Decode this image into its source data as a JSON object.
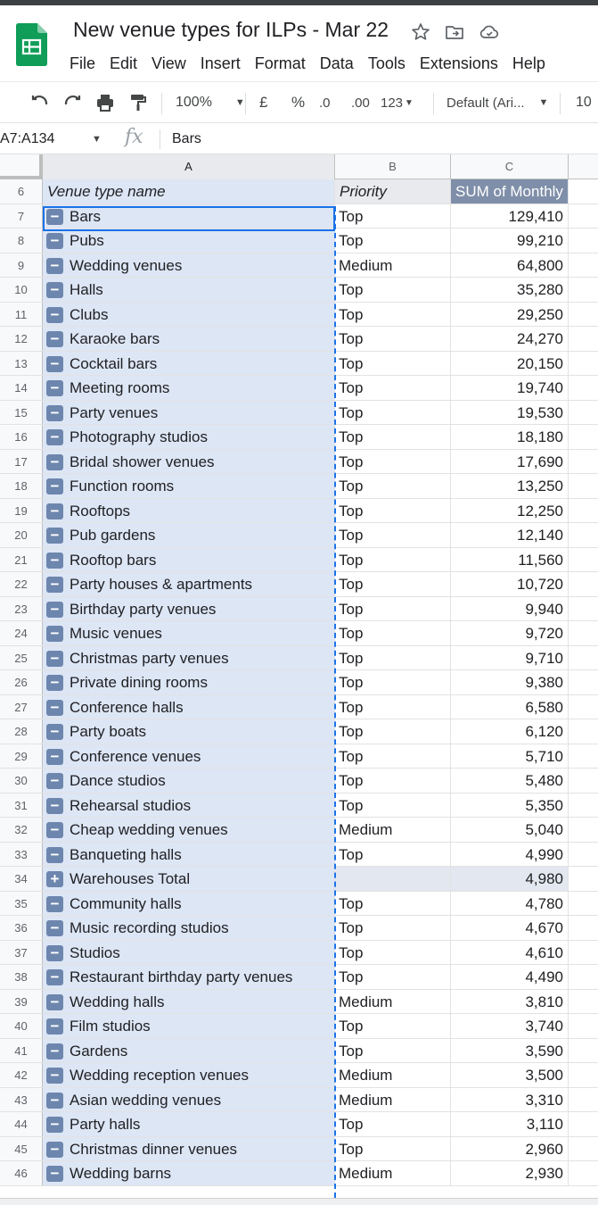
{
  "document": {
    "title": "New venue types for ILPs - Mar 22"
  },
  "menu": [
    "File",
    "Edit",
    "View",
    "Insert",
    "Format",
    "Data",
    "Tools",
    "Extensions",
    "Help"
  ],
  "toolbar": {
    "zoom": "100%",
    "currency": "£",
    "percent": "%",
    "decrease_decimals": ".0",
    "increase_decimals": ".00",
    "more_formats": "123",
    "font": "Default (Ari...",
    "font_size": "10"
  },
  "formula_bar": {
    "name_box": "A7:A134",
    "fx": "fx",
    "value": "Bars"
  },
  "columns": [
    "A",
    "B",
    "C"
  ],
  "header_row": {
    "row_number": "6",
    "col_a": "Venue type name",
    "col_b": "Priority",
    "col_c": "SUM of Monthly"
  },
  "rows": [
    {
      "n": "7",
      "name": "Bars",
      "priority": "Top",
      "value": "129,410"
    },
    {
      "n": "8",
      "name": "Pubs",
      "priority": "Top",
      "value": "99,210"
    },
    {
      "n": "9",
      "name": "Wedding venues",
      "priority": "Medium",
      "value": "64,800"
    },
    {
      "n": "10",
      "name": "Halls",
      "priority": "Top",
      "value": "35,280"
    },
    {
      "n": "11",
      "name": "Clubs",
      "priority": "Top",
      "value": "29,250"
    },
    {
      "n": "12",
      "name": "Karaoke bars",
      "priority": "Top",
      "value": "24,270"
    },
    {
      "n": "13",
      "name": "Cocktail bars",
      "priority": "Top",
      "value": "20,150"
    },
    {
      "n": "14",
      "name": "Meeting rooms",
      "priority": "Top",
      "value": "19,740"
    },
    {
      "n": "15",
      "name": "Party venues",
      "priority": "Top",
      "value": "19,530"
    },
    {
      "n": "16",
      "name": "Photography studios",
      "priority": "Top",
      "value": "18,180"
    },
    {
      "n": "17",
      "name": "Bridal shower venues",
      "priority": "Top",
      "value": "17,690"
    },
    {
      "n": "18",
      "name": "Function rooms",
      "priority": "Top",
      "value": "13,250"
    },
    {
      "n": "19",
      "name": "Rooftops",
      "priority": "Top",
      "value": "12,250"
    },
    {
      "n": "20",
      "name": "Pub gardens",
      "priority": "Top",
      "value": "12,140"
    },
    {
      "n": "21",
      "name": "Rooftop bars",
      "priority": "Top",
      "value": "11,560"
    },
    {
      "n": "22",
      "name": "Party houses & apartments",
      "priority": "Top",
      "value": "10,720"
    },
    {
      "n": "23",
      "name": "Birthday party venues",
      "priority": "Top",
      "value": "9,940"
    },
    {
      "n": "24",
      "name": "Music venues",
      "priority": "Top",
      "value": "9,720"
    },
    {
      "n": "25",
      "name": "Christmas party venues",
      "priority": "Top",
      "value": "9,710"
    },
    {
      "n": "26",
      "name": "Private dining rooms",
      "priority": "Top",
      "value": "9,380"
    },
    {
      "n": "27",
      "name": "Conference halls",
      "priority": "Top",
      "value": "6,580"
    },
    {
      "n": "28",
      "name": "Party boats",
      "priority": "Top",
      "value": "6,120"
    },
    {
      "n": "29",
      "name": "Conference venues",
      "priority": "Top",
      "value": "5,710"
    },
    {
      "n": "30",
      "name": "Dance studios",
      "priority": "Top",
      "value": "5,480"
    },
    {
      "n": "31",
      "name": "Rehearsal studios",
      "priority": "Top",
      "value": "5,350"
    },
    {
      "n": "32",
      "name": "Cheap wedding venues",
      "priority": "Medium",
      "value": "5,040"
    },
    {
      "n": "33",
      "name": "Banqueting halls",
      "priority": "Top",
      "value": "4,990"
    },
    {
      "n": "34",
      "name": "Warehouses Total",
      "priority": "",
      "value": "4,980",
      "collapsed": true
    },
    {
      "n": "35",
      "name": "Community halls",
      "priority": "Top",
      "value": "4,780"
    },
    {
      "n": "36",
      "name": "Music recording studios",
      "priority": "Top",
      "value": "4,670"
    },
    {
      "n": "37",
      "name": "Studios",
      "priority": "Top",
      "value": "4,610"
    },
    {
      "n": "38",
      "name": "Restaurant birthday party venues",
      "priority": "Top",
      "value": "4,490"
    },
    {
      "n": "39",
      "name": "Wedding halls",
      "priority": "Medium",
      "value": "3,810"
    },
    {
      "n": "40",
      "name": "Film studios",
      "priority": "Top",
      "value": "3,740"
    },
    {
      "n": "41",
      "name": "Gardens",
      "priority": "Top",
      "value": "3,590"
    },
    {
      "n": "42",
      "name": "Wedding reception venues",
      "priority": "Medium",
      "value": "3,500"
    },
    {
      "n": "43",
      "name": "Asian wedding venues",
      "priority": "Medium",
      "value": "3,310"
    },
    {
      "n": "44",
      "name": "Party halls",
      "priority": "Top",
      "value": "3,110"
    },
    {
      "n": "45",
      "name": "Christmas dinner venues",
      "priority": "Top",
      "value": "2,960"
    },
    {
      "n": "46",
      "name": "Wedding barns",
      "priority": "Medium",
      "value": "2,930"
    }
  ],
  "icons": {
    "undo": "undo-icon",
    "redo": "redo-icon",
    "print": "print-icon",
    "paint_format": "paint-format-icon",
    "star": "star-icon",
    "move": "move-to-folder-icon",
    "cloud": "cloud-saved-icon",
    "collapse": "minus-icon",
    "expand": "plus-icon"
  },
  "colors": {
    "selection_fill": "#dde6f5",
    "active_border": "#1a73e8",
    "pivot_header": "#7f8fa9",
    "toggle_button": "#6d86ae",
    "sheets_green": "#0f9d58"
  }
}
